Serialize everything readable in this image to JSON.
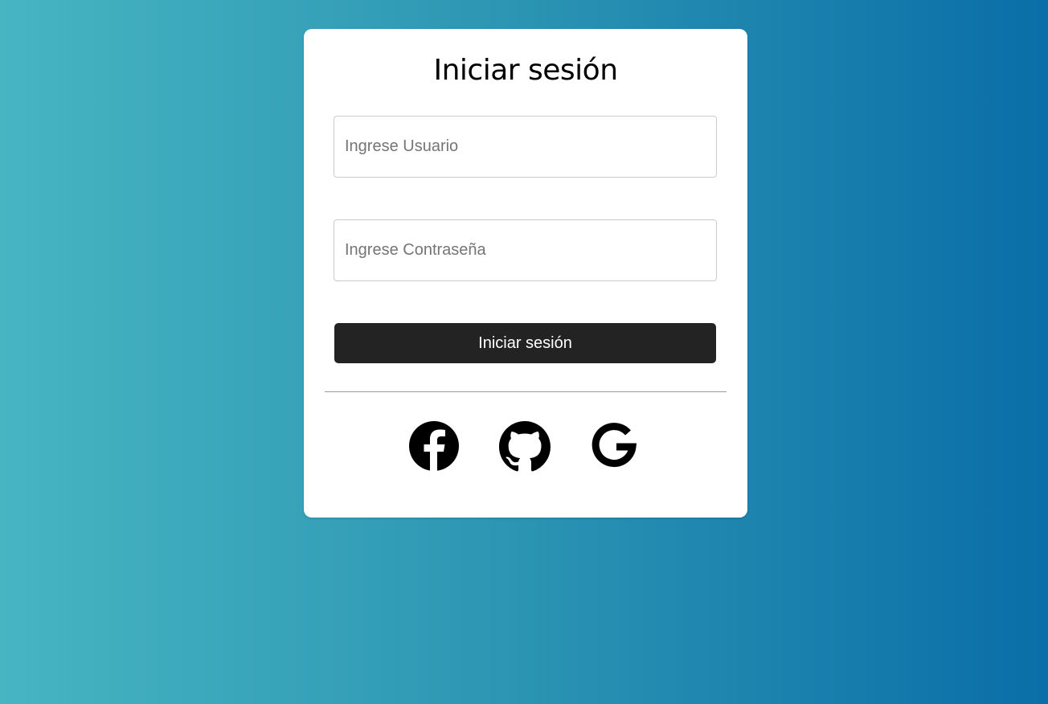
{
  "login": {
    "title": "Iniciar sesión",
    "username_placeholder": "Ingrese Usuario",
    "username_value": "",
    "password_placeholder": "Ingrese Contraseña",
    "password_value": "",
    "submit_label": "Iniciar sesión"
  },
  "social": {
    "icons": [
      "facebook-icon",
      "github-icon",
      "google-icon"
    ]
  },
  "colors": {
    "gradient_start": "#47b5c2",
    "gradient_end": "#0a6ea8",
    "button_bg": "#232323",
    "card_bg": "#ffffff"
  }
}
